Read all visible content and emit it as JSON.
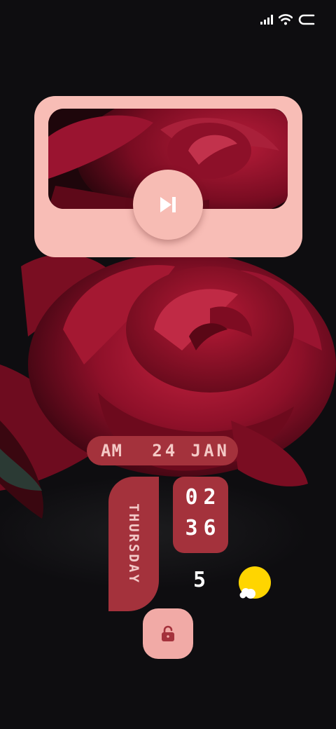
{
  "status_bar": {
    "icons": [
      "signal-icon",
      "wifi-icon",
      "battery-icon"
    ]
  },
  "media_widget": {
    "action": "skip-next-icon"
  },
  "clock": {
    "ampm": "AM",
    "date": "24 JAN",
    "day": "THURSDAY",
    "hours": "02",
    "minutes": "36"
  },
  "weather": {
    "temperature": "5",
    "icon": "partly-cloudy-icon"
  },
  "lock": {
    "icon": "unlock-icon"
  },
  "colors": {
    "background": "#0e0d10",
    "widget_pink": "#f8bdb6",
    "widget_red": "#a4323c",
    "sun": "#ffd500"
  }
}
